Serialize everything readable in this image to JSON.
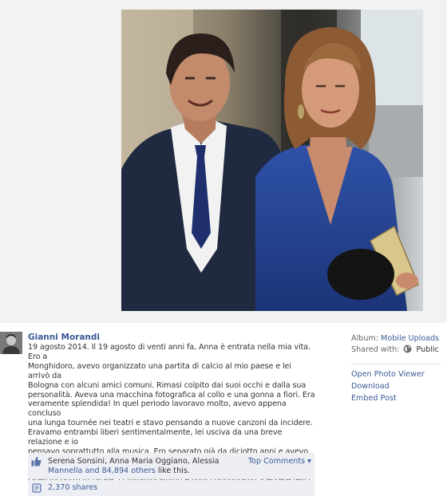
{
  "post": {
    "author": "Gianni Morandi",
    "caption": "19 agosto 2014. Il 19 agosto di venti anni fa, Anna è entrata nella mia vita. Ero a\nMonghidoro, avevo organizzato una partita di calcio al mio paese e lei arrivò da\nBologna con alcuni amici comuni. Rimasi colpito dai suoi occhi e dalla sua\npersonalità. Aveva una macchina fotografica al collo e una gonna a fiori. Era\nveramente splendida! In quel periodo lavoravo molto, avevo appena concluso\nuna lunga tournée nei teatri e stavo pensando a nuove canzoni da incidere.\nEravamo entrambi liberi sentimentalmente, lei usciva da una breve relazione e io\npensavo soprattutto alla musica. Ero separato già da diciotto anni e avevo avuto\nqualche storia, ma evidentemente non quella giusta.\nQuell'incontro fu fatale, ci innamorammo e oggi continuiamo a essere felici\ninsieme."
  },
  "ufi": {
    "likers_line1": "Serena Sonsini, Anna Maria Oggiano, Alessia",
    "likers_line2_link": "Mannella and 84,894 others",
    "likers_line2_rest": " like this.",
    "top_comments": "Top Comments ▾",
    "shares": "2,370 shares"
  },
  "side": {
    "album_label": "Album:",
    "album_value": "Mobile Uploads",
    "shared_label": "Shared with:",
    "shared_value": "Public",
    "actions": [
      "Open Photo Viewer",
      "Download",
      "Embed Post"
    ]
  },
  "icons": {
    "like": "thumbs-up-icon",
    "share": "share-icon",
    "globe": "globe-icon"
  },
  "colors": {
    "link": "#3b5998",
    "ufi_bg": "#edeff4",
    "text": "#333333"
  }
}
